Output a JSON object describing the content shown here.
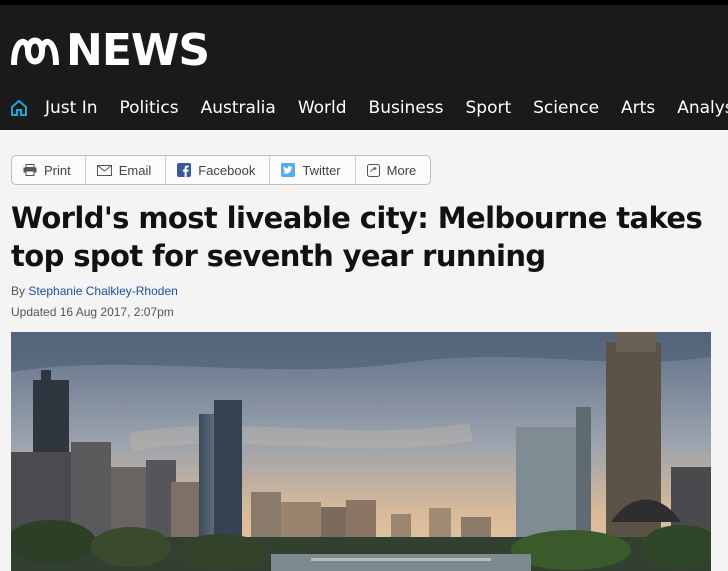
{
  "site": {
    "logo_text": "NEWS",
    "logo_icon": "abc-wave-icon"
  },
  "nav": {
    "home_icon": "home-icon",
    "items": [
      "Just In",
      "Politics",
      "Australia",
      "World",
      "Business",
      "Sport",
      "Science",
      "Arts",
      "Analysis"
    ]
  },
  "share": {
    "print": "Print",
    "email": "Email",
    "facebook": "Facebook",
    "twitter": "Twitter",
    "more": "More"
  },
  "article": {
    "headline": "World's most liveable city: Melbourne takes top spot for seventh year running",
    "by": "By",
    "author": "Stephanie Chalkley-Rhoden",
    "updated": "Updated 16 Aug 2017, 2:07pm"
  },
  "colors": {
    "header_bg": "#1a1a1a",
    "home_icon": "#1aa6d8",
    "facebook": "#3b5998",
    "twitter": "#55acee",
    "author_link": "#1b4fa0"
  }
}
